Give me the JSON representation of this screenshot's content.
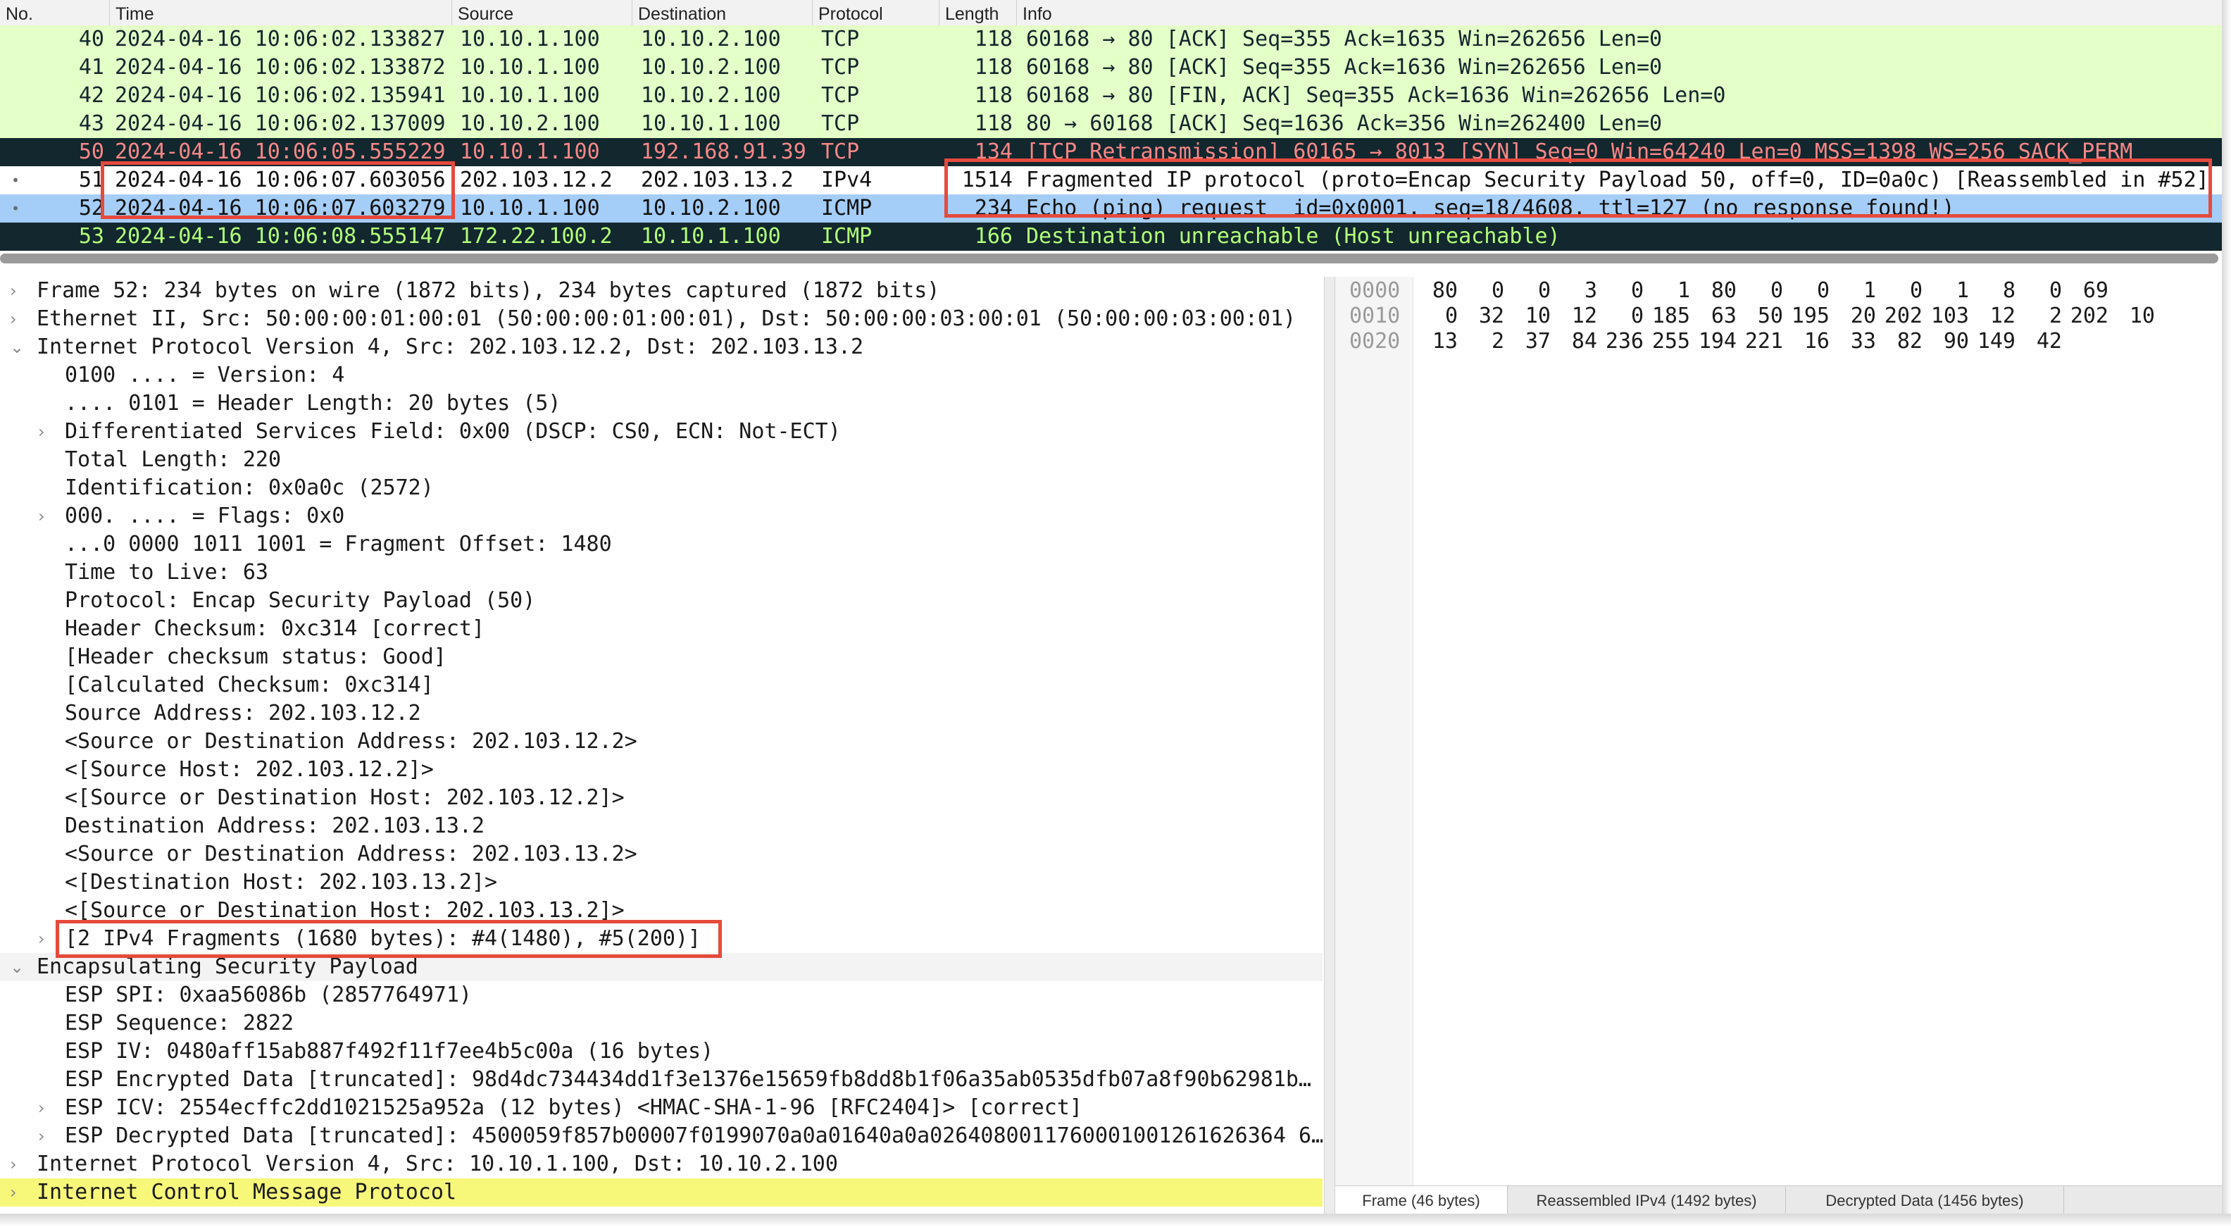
{
  "colors": {
    "tcp_row_bg": "#e4ffc7",
    "tcp_row_fg": "#12272e",
    "retrans_row_bg": "#12272e",
    "retrans_row_fg": "#f78787",
    "selected_bg": "#a4cdf7",
    "icmp_dark_bg": "#12272e",
    "icmp_dark_fg": "#b3ff79",
    "highlight": "#e64a3d",
    "yellow_row": "#f7f77a"
  },
  "packet_list": {
    "columns": [
      "No.",
      "Time",
      "Source",
      "Destination",
      "Protocol",
      "Length",
      "Info"
    ],
    "rows": [
      {
        "no": "40",
        "mark": "",
        "time": "2024-04-16 10:06:02.133827",
        "src": "10.10.1.100",
        "dst": "10.10.2.100",
        "proto": "TCP",
        "len": "118",
        "info": "60168 → 80 [ACK] Seq=355 Ack=1635 Win=262656 Len=0"
      },
      {
        "no": "41",
        "mark": "",
        "time": "2024-04-16 10:06:02.133872",
        "src": "10.10.1.100",
        "dst": "10.10.2.100",
        "proto": "TCP",
        "len": "118",
        "info": "60168 → 80 [ACK] Seq=355 Ack=1636 Win=262656 Len=0"
      },
      {
        "no": "42",
        "mark": "",
        "time": "2024-04-16 10:06:02.135941",
        "src": "10.10.1.100",
        "dst": "10.10.2.100",
        "proto": "TCP",
        "len": "118",
        "info": "60168 → 80 [FIN, ACK] Seq=355 Ack=1636 Win=262656 Len=0"
      },
      {
        "no": "43",
        "mark": "",
        "time": "2024-04-16 10:06:02.137009",
        "src": "10.10.2.100",
        "dst": "10.10.1.100",
        "proto": "TCP",
        "len": "118",
        "info": "80 → 60168 [ACK] Seq=1636 Ack=356 Win=262400 Len=0"
      },
      {
        "no": "50",
        "mark": "",
        "time": "2024-04-16 10:06:05.555229",
        "src": "10.10.1.100",
        "dst": "192.168.91.39",
        "proto": "TCP",
        "len": "134",
        "info": "[TCP Retransmission] 60165 → 8013 [SYN] Seq=0 Win=64240 Len=0 MSS=1398 WS=256 SACK_PERM"
      },
      {
        "no": "51",
        "mark": "•",
        "time": "2024-04-16 10:06:07.603056",
        "src": "202.103.12.2",
        "dst": "202.103.13.2",
        "proto": "IPv4",
        "len": "1514",
        "info": "Fragmented IP protocol (proto=Encap Security Payload 50, off=0, ID=0a0c) [Reassembled in #52]"
      },
      {
        "no": "52",
        "mark": "•",
        "time": "2024-04-16 10:06:07.603279",
        "src": "10.10.1.100",
        "dst": "10.10.2.100",
        "proto": "ICMP",
        "len": "234",
        "info": "Echo (ping) request  id=0x0001, seq=18/4608, ttl=127 (no response found!)"
      },
      {
        "no": "53",
        "mark": "",
        "time": "2024-04-16 10:06:08.555147",
        "src": "172.22.100.2",
        "dst": "10.10.1.100",
        "proto": "ICMP",
        "len": "166",
        "info": "Destination unreachable (Host unreachable)"
      }
    ]
  },
  "detail": {
    "lines": [
      {
        "arrow": "›",
        "indent": 0,
        "text": "Frame 52: 234 bytes on wire (1872 bits), 234 bytes captured (1872 bits)"
      },
      {
        "arrow": "›",
        "indent": 0,
        "text": "Ethernet II, Src: 50:00:00:01:00:01 (50:00:00:01:00:01), Dst: 50:00:00:03:00:01 (50:00:00:03:00:01)"
      },
      {
        "arrow": "⌄",
        "indent": 0,
        "text": "Internet Protocol Version 4, Src: 202.103.12.2, Dst: 202.103.13.2"
      },
      {
        "arrow": "",
        "indent": 1,
        "text": "0100 .... = Version: 4"
      },
      {
        "arrow": "",
        "indent": 1,
        "text": ".... 0101 = Header Length: 20 bytes (5)"
      },
      {
        "arrow": "›",
        "indent": 1,
        "text": "Differentiated Services Field: 0x00 (DSCP: CS0, ECN: Not-ECT)"
      },
      {
        "arrow": "",
        "indent": 1,
        "text": "Total Length: 220"
      },
      {
        "arrow": "",
        "indent": 1,
        "text": "Identification: 0x0a0c (2572)"
      },
      {
        "arrow": "›",
        "indent": 1,
        "text": "000. .... = Flags: 0x0"
      },
      {
        "arrow": "",
        "indent": 1,
        "text": "...0 0000 1011 1001 = Fragment Offset: 1480"
      },
      {
        "arrow": "",
        "indent": 1,
        "text": "Time to Live: 63"
      },
      {
        "arrow": "",
        "indent": 1,
        "text": "Protocol: Encap Security Payload (50)"
      },
      {
        "arrow": "",
        "indent": 1,
        "text": "Header Checksum: 0xc314 [correct]"
      },
      {
        "arrow": "",
        "indent": 1,
        "text": "[Header checksum status: Good]"
      },
      {
        "arrow": "",
        "indent": 1,
        "text": "[Calculated Checksum: 0xc314]"
      },
      {
        "arrow": "",
        "indent": 1,
        "text": "Source Address: 202.103.12.2"
      },
      {
        "arrow": "",
        "indent": 1,
        "text": "<Source or Destination Address: 202.103.12.2>"
      },
      {
        "arrow": "",
        "indent": 1,
        "text": "<[Source Host: 202.103.12.2]>"
      },
      {
        "arrow": "",
        "indent": 1,
        "text": "<[Source or Destination Host: 202.103.12.2]>"
      },
      {
        "arrow": "",
        "indent": 1,
        "text": "Destination Address: 202.103.13.2"
      },
      {
        "arrow": "",
        "indent": 1,
        "text": "<Source or Destination Address: 202.103.13.2>"
      },
      {
        "arrow": "",
        "indent": 1,
        "text": "<[Destination Host: 202.103.13.2]>"
      },
      {
        "arrow": "",
        "indent": 1,
        "text": "<[Source or Destination Host: 202.103.13.2]>"
      },
      {
        "arrow": "›",
        "indent": 1,
        "text": "[2 IPv4 Fragments (1680 bytes): #4(1480), #5(200)]"
      },
      {
        "arrow": "⌄",
        "indent": 0,
        "text": "Encapsulating Security Payload"
      },
      {
        "arrow": "",
        "indent": 1,
        "text": "ESP SPI: 0xaa56086b (2857764971)"
      },
      {
        "arrow": "",
        "indent": 1,
        "text": "ESP Sequence: 2822"
      },
      {
        "arrow": "",
        "indent": 1,
        "text": "ESP IV: 0480aff15ab887f492f11f7ee4b5c00a (16 bytes)"
      },
      {
        "arrow": "",
        "indent": 1,
        "text": "ESP Encrypted Data [truncated]: 98d4dc734434dd1f3e1376e15659fb8dd8b1f06a35ab0535dfb07a8f90b62981b…"
      },
      {
        "arrow": "›",
        "indent": 1,
        "text": "ESP ICV: 2554ecffc2dd1021525a952a (12 bytes) <HMAC-SHA-1-96 [RFC2404]> [correct]"
      },
      {
        "arrow": "›",
        "indent": 1,
        "text": "ESP Decrypted Data [truncated]: 4500059f857b00007f0199070a0a01640a0a0264080011760001001261626364 6…"
      },
      {
        "arrow": "›",
        "indent": 0,
        "text": "Internet Protocol Version 4, Src: 10.10.1.100, Dst: 10.10.2.100"
      },
      {
        "arrow": "›",
        "indent": 0,
        "text": "Internet Control Message Protocol"
      }
    ]
  },
  "bytes": {
    "rows": [
      {
        "offset": "0000",
        "values": [
          "80",
          "0",
          "0",
          "3",
          "0",
          "1",
          "80",
          "0",
          "0",
          "1",
          "0",
          "1",
          "8",
          "0",
          "69"
        ]
      },
      {
        "offset": "0010",
        "values": [
          "0",
          "32",
          "10",
          "12",
          "0",
          "185",
          "63",
          "50",
          "195",
          "20",
          "202",
          "103",
          "12",
          "2",
          "202",
          "10"
        ]
      },
      {
        "offset": "0020",
        "values": [
          "13",
          "2",
          "37",
          "84",
          "236",
          "255",
          "194",
          "221",
          "16",
          "33",
          "82",
          "90",
          "149",
          "42"
        ]
      }
    ],
    "tabs": [
      "Frame (46 bytes)",
      "Reassembled IPv4 (1492 bytes)",
      "Decrypted Data (1456 bytes)"
    ]
  }
}
